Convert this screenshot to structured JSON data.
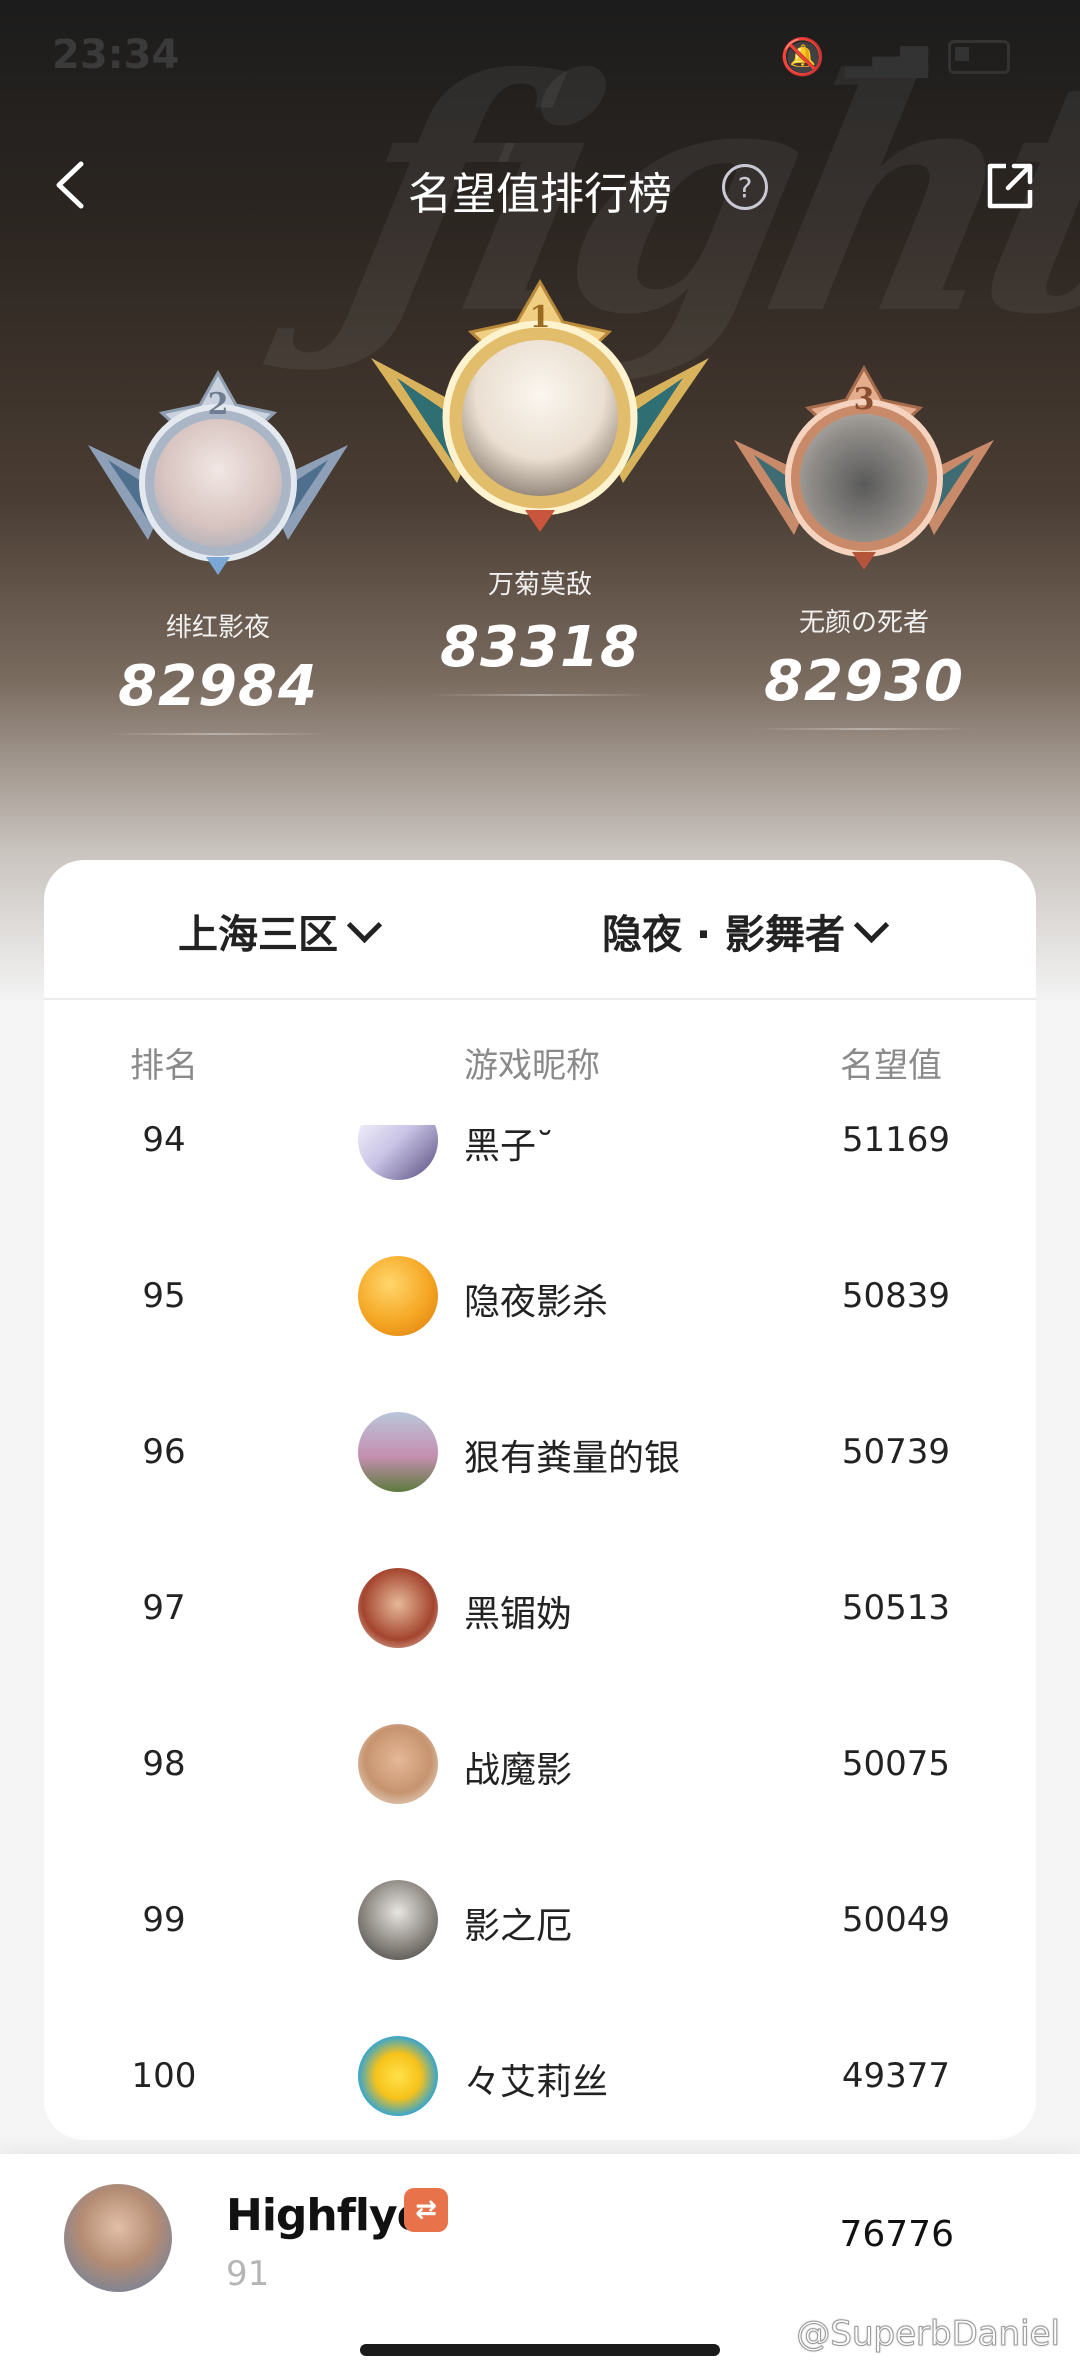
{
  "status": {
    "time": "23:34"
  },
  "header": {
    "title": "名望值排行榜"
  },
  "podium": [
    {
      "place": "2",
      "name": "绯红影夜",
      "score": "82984"
    },
    {
      "place": "1",
      "name": "万菊莫敌",
      "score": "83318"
    },
    {
      "place": "3",
      "name": "无颜の死者",
      "score": "82930"
    }
  ],
  "filters": {
    "server": "上海三区",
    "class": "隐夜 · 影舞者"
  },
  "columns": {
    "rank": "排名",
    "nickname": "游戏昵称",
    "prestige": "名望值"
  },
  "rows": [
    {
      "rank": "94",
      "name": "黑子˘",
      "score": "51169"
    },
    {
      "rank": "95",
      "name": "隐夜影杀",
      "score": "50839"
    },
    {
      "rank": "96",
      "name": "狠有粪量的银",
      "score": "50739"
    },
    {
      "rank": "97",
      "name": "黑镅妫",
      "score": "50513"
    },
    {
      "rank": "98",
      "name": "战魔影",
      "score": "50075"
    },
    {
      "rank": "99",
      "name": "影之厄",
      "score": "50049"
    },
    {
      "rank": "100",
      "name": "々艾莉丝",
      "score": "49377"
    }
  ],
  "me": {
    "name": "Highflyer",
    "rank": "91",
    "score": "76776"
  },
  "watermark": "@SuperbDaniel",
  "colors": {
    "gold": "#d9b25c",
    "silver": "#b9c3d1",
    "bronze": "#c98a6a",
    "tag": "#e8734a"
  }
}
